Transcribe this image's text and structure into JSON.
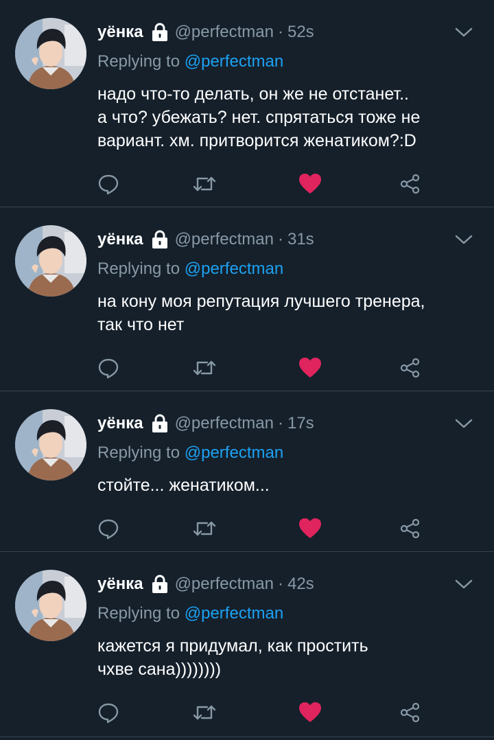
{
  "colors": {
    "background": "#15202b",
    "divider": "#38444d",
    "text": "#ffffff",
    "secondary": "#8899a6",
    "link": "#1da1f2",
    "like": "#e0245e"
  },
  "tweets": [
    {
      "name": "уёнка",
      "handle": "@perfectman",
      "dot": "·",
      "time": "52s",
      "reply_prefix": "Replying to ",
      "reply_to": "@perfectman",
      "lines": [
        "надо что-то делать, он же не отстанет..",
        "а что? убежать? нет. спрятаться тоже не",
        "вариант. хм. притворится женатиком?:D"
      ],
      "liked": true
    },
    {
      "name": "уёнка",
      "handle": "@perfectman",
      "dot": "·",
      "time": "31s",
      "reply_prefix": "Replying to ",
      "reply_to": "@perfectman",
      "lines": [
        "на кону моя репутация лучшего тренера,",
        "так что нет"
      ],
      "liked": true
    },
    {
      "name": "уёнка",
      "handle": "@perfectman",
      "dot": "·",
      "time": "17s",
      "reply_prefix": "Replying to ",
      "reply_to": "@perfectman",
      "lines": [
        "стойте... женатиком..."
      ],
      "liked": true
    },
    {
      "name": "уёнка",
      "handle": "@perfectman",
      "dot": "·",
      "time": "42s",
      "reply_prefix": "Replying to ",
      "reply_to": "@perfectman",
      "lines": [
        "кажется я придумал, как простить",
        "чхве сана))))))))"
      ],
      "liked": true
    }
  ],
  "icons": {
    "lock": "lock-icon",
    "chevron": "chevron-down-icon",
    "reply": "reply-icon",
    "retweet": "retweet-icon",
    "like": "heart-icon",
    "share": "share-icon"
  }
}
